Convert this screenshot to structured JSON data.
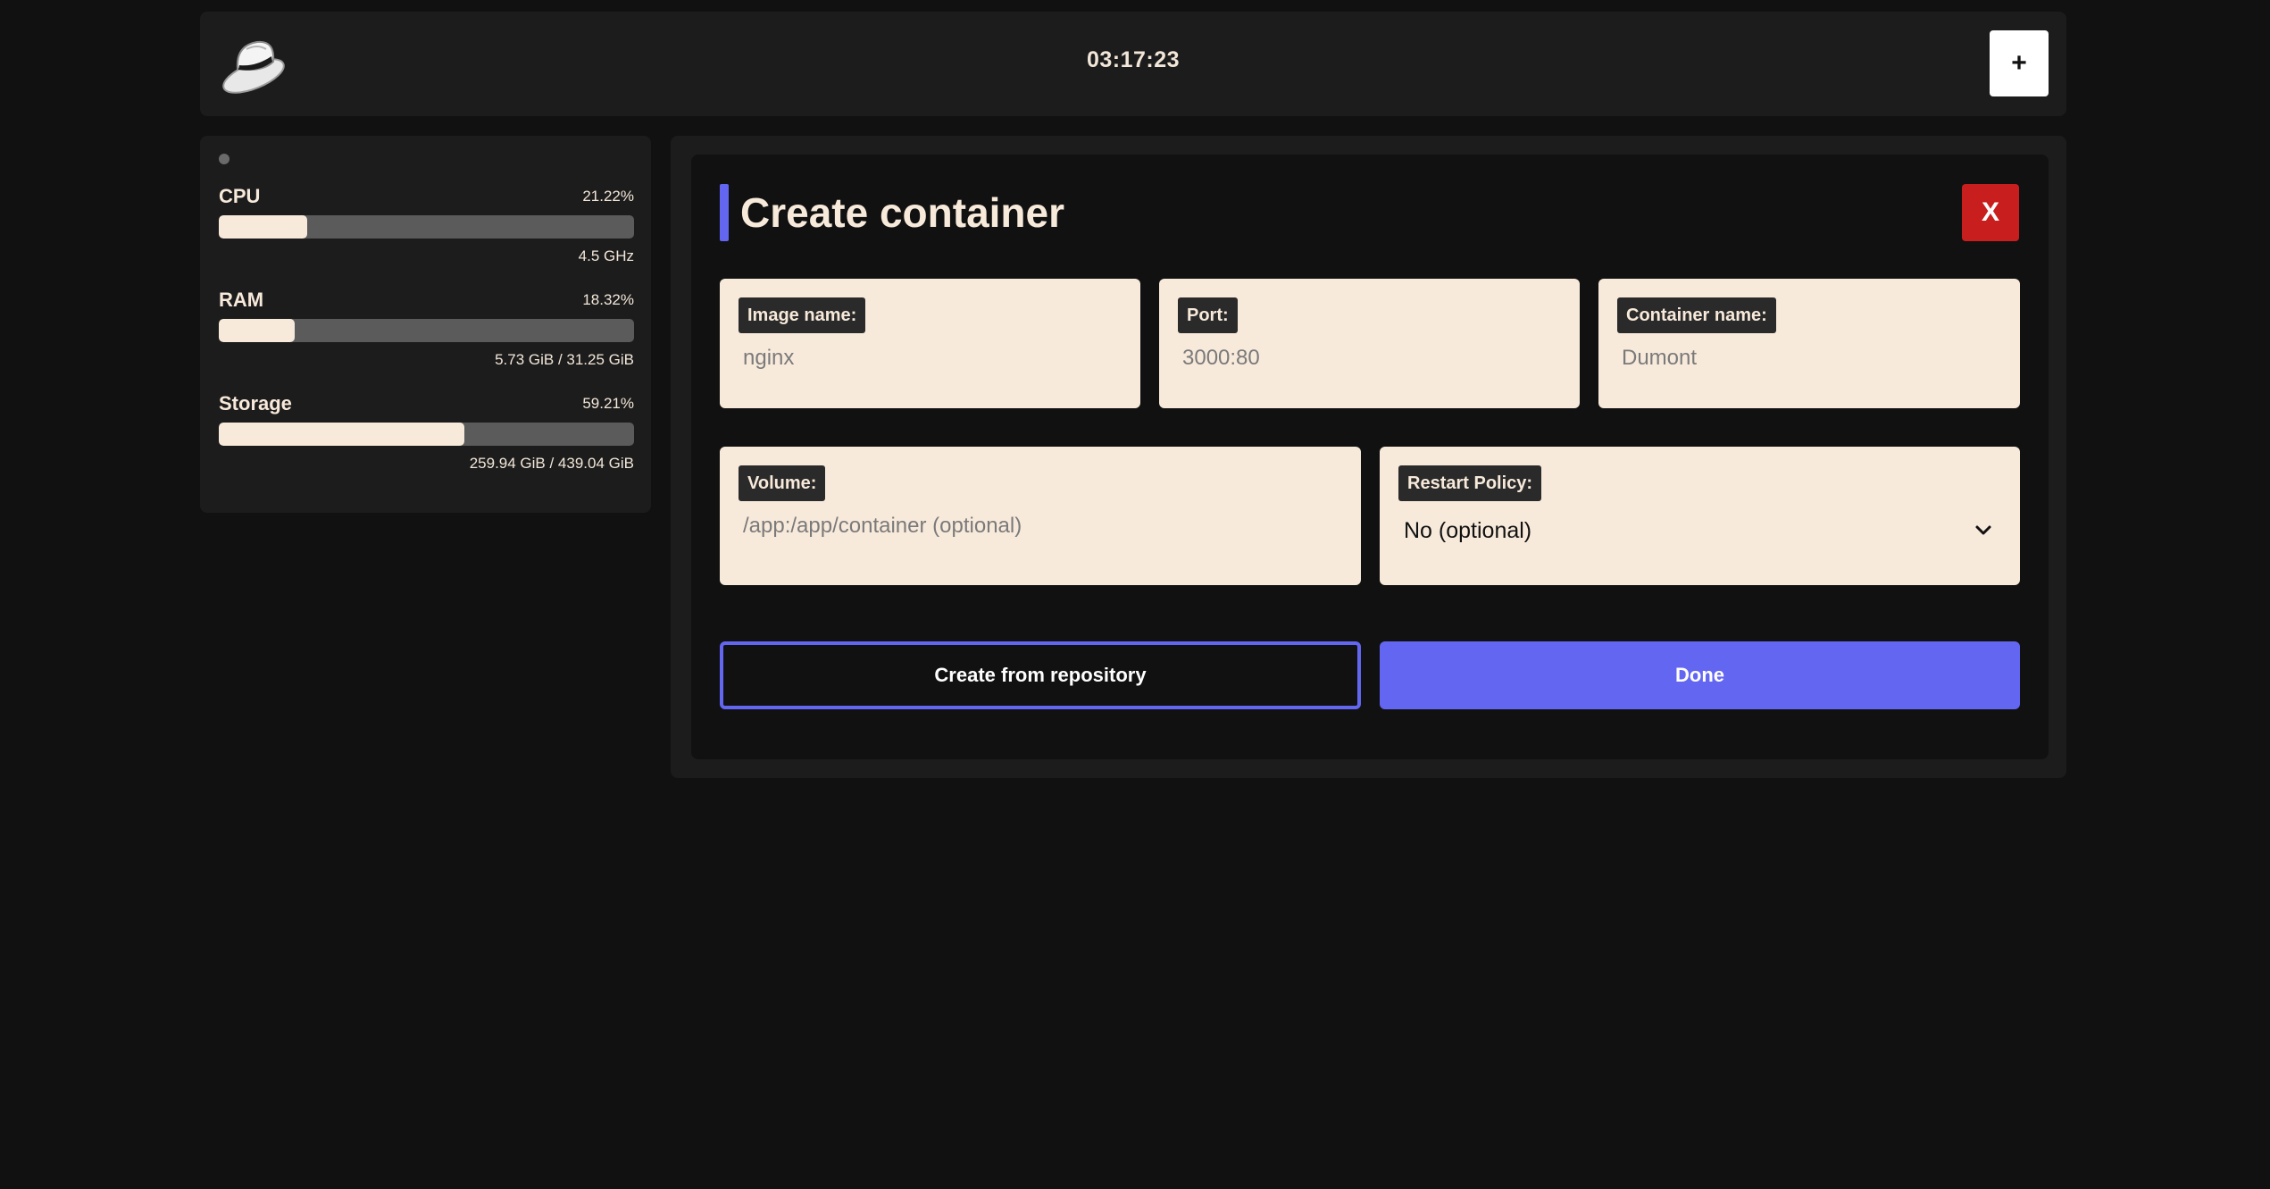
{
  "header": {
    "clock": "03:17:23",
    "add_label": "+",
    "logo_icon": "fedora-hat-icon"
  },
  "stats": {
    "cpu": {
      "name": "CPU",
      "percent": "21.22%",
      "fill": 0.2122,
      "detail": "4.5 GHz"
    },
    "ram": {
      "name": "RAM",
      "percent": "18.32%",
      "fill": 0.1832,
      "detail": "5.73 GiB / 31.25 GiB"
    },
    "storage": {
      "name": "Storage",
      "percent": "59.21%",
      "fill": 0.5921,
      "detail": "259.94 GiB / 439.04 GiB"
    }
  },
  "modal": {
    "title": "Create container",
    "close_label": "X",
    "fields": {
      "image": {
        "label": "Image name:",
        "placeholder": "nginx",
        "value": ""
      },
      "port": {
        "label": "Port:",
        "placeholder": "3000:80",
        "value": ""
      },
      "container": {
        "label": "Container name:",
        "placeholder": "Dumont",
        "value": ""
      },
      "volume": {
        "label": "Volume:",
        "placeholder": "/app:/app/container (optional)",
        "value": ""
      },
      "restart": {
        "label": "Restart Policy:",
        "selected": "No (optional)"
      }
    },
    "repo_button_label": "Create from repository",
    "done_button_label": "Done"
  },
  "colors": {
    "accent": "#6366f1",
    "danger": "#c81e1e",
    "cream": "#f8eadb",
    "background": "#111111",
    "panel": "#1c1c1c"
  }
}
